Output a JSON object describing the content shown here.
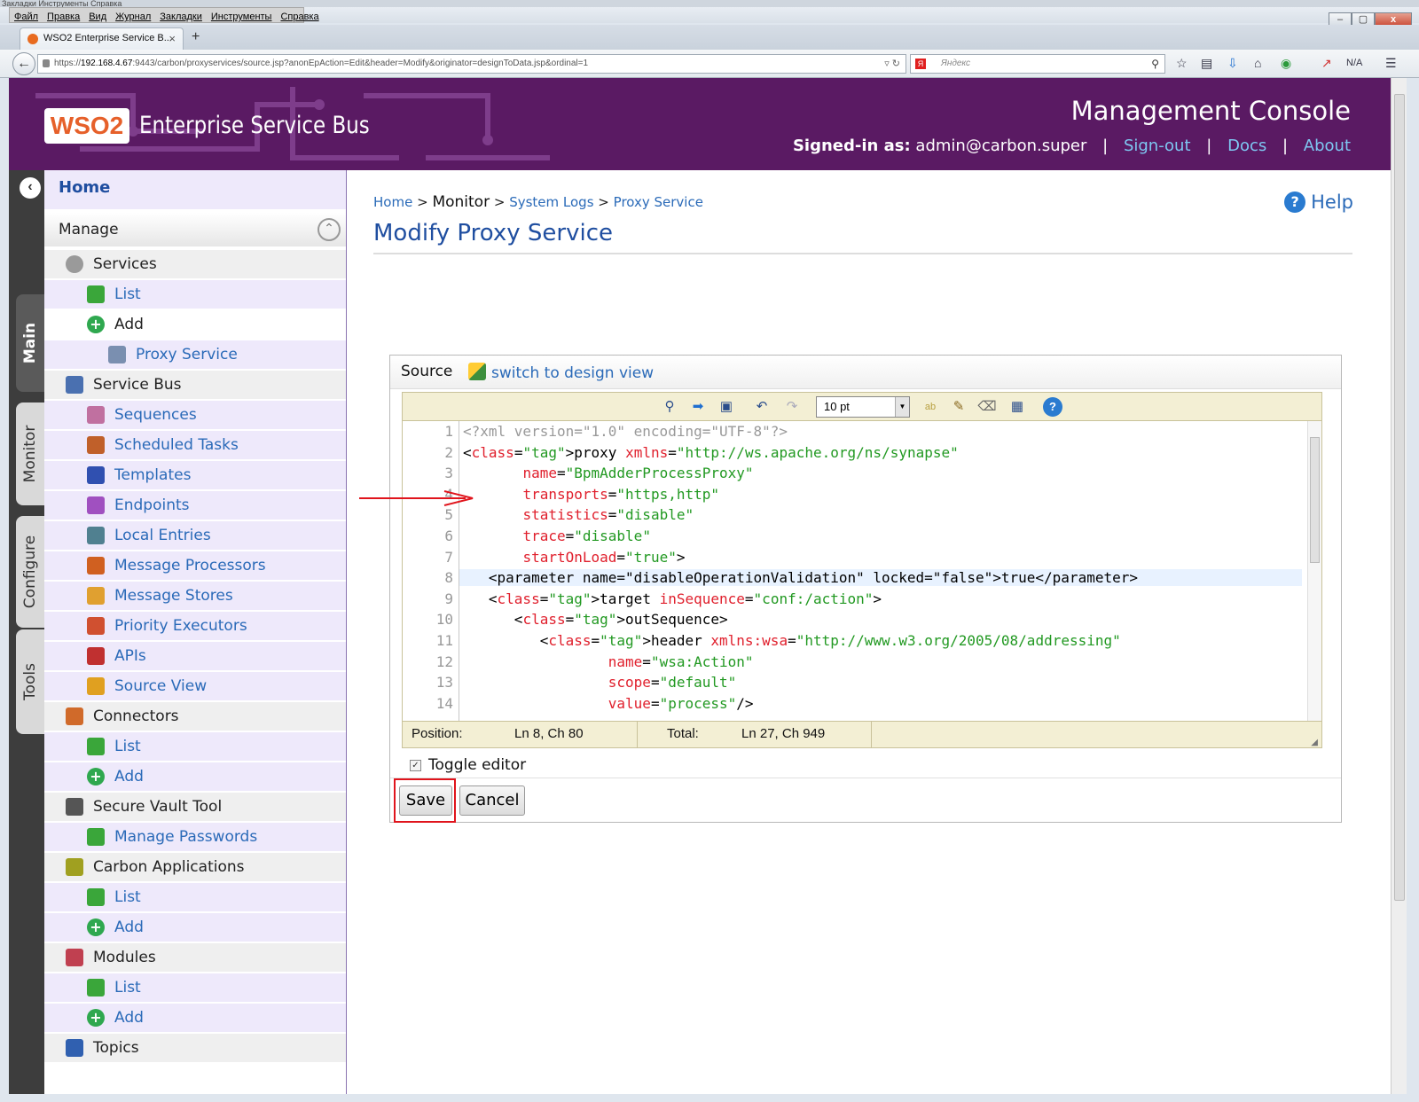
{
  "browser": {
    "ghost_menu": "Закладки  Инструменты  Справка",
    "menu": [
      "Файл",
      "Правка",
      "Вид",
      "Журнал",
      "Закладки",
      "Инструменты",
      "Справка"
    ],
    "tab_title": "WSO2 Enterprise Service B...",
    "tab_close": "×",
    "new_tab": "+",
    "url_prefix": "https://",
    "url_host": "192.168.4.67",
    "url_rest": ":9443/carbon/proxyservices/source.jsp?anonEpAction=Edit&header=Modify&originator=designToData.jsp&ordinal=1",
    "search_placeholder": "Яндекс",
    "na_label": "N/A",
    "window_controls": [
      "–",
      "▢",
      "x"
    ]
  },
  "header": {
    "logo_text": "WSO2",
    "product": "Enterprise Service Bus",
    "console_title": "Management Console",
    "signed_in_label": "Signed-in as:",
    "signed_in_user": "admin@carbon.super",
    "signout": "Sign-out",
    "docs": "Docs",
    "about": "About",
    "sep": "|",
    "color": "#5a1a63"
  },
  "vtabs": [
    "Main",
    "Monitor",
    "Configure",
    "Tools"
  ],
  "sidebar": {
    "home": "Home",
    "manage": "Manage",
    "items": [
      {
        "label": "Services",
        "level": 1,
        "icon": "gear-icon"
      },
      {
        "label": "List",
        "level": 2,
        "icon": "list-icon"
      },
      {
        "label": "Add",
        "level": 2,
        "icon": "add-icon",
        "plain": true
      },
      {
        "label": "Proxy Service",
        "level": 3,
        "icon": "proxy-icon"
      },
      {
        "label": "Service Bus",
        "level": 1,
        "icon": "servicebus-icon"
      },
      {
        "label": "Sequences",
        "level": 2,
        "icon": "sequences-icon"
      },
      {
        "label": "Scheduled Tasks",
        "level": 2,
        "icon": "tasks-icon"
      },
      {
        "label": "Templates",
        "level": 2,
        "icon": "templates-icon"
      },
      {
        "label": "Endpoints",
        "level": 2,
        "icon": "endpoints-icon"
      },
      {
        "label": "Local Entries",
        "level": 2,
        "icon": "local-entries-icon"
      },
      {
        "label": "Message Processors",
        "level": 2,
        "icon": "processors-icon"
      },
      {
        "label": "Message Stores",
        "level": 2,
        "icon": "stores-icon"
      },
      {
        "label": "Priority Executors",
        "level": 2,
        "icon": "executors-icon"
      },
      {
        "label": "APIs",
        "level": 2,
        "icon": "apis-icon"
      },
      {
        "label": "Source View",
        "level": 2,
        "icon": "source-view-icon"
      },
      {
        "label": "Connectors",
        "level": 1,
        "icon": "connectors-icon"
      },
      {
        "label": "List",
        "level": 2,
        "icon": "list-icon"
      },
      {
        "label": "Add",
        "level": 2,
        "icon": "add-icon"
      },
      {
        "label": "Secure Vault Tool",
        "level": 1,
        "icon": "lock-icon"
      },
      {
        "label": "Manage Passwords",
        "level": 2,
        "icon": "list-icon"
      },
      {
        "label": "Carbon Applications",
        "level": 1,
        "icon": "carbon-apps-icon"
      },
      {
        "label": "List",
        "level": 2,
        "icon": "list-icon"
      },
      {
        "label": "Add",
        "level": 2,
        "icon": "add-icon"
      },
      {
        "label": "Modules",
        "level": 1,
        "icon": "modules-icon"
      },
      {
        "label": "List",
        "level": 2,
        "icon": "list-icon"
      },
      {
        "label": "Add",
        "level": 2,
        "icon": "add-icon"
      },
      {
        "label": "Topics",
        "level": 1,
        "icon": "topics-icon"
      }
    ]
  },
  "main": {
    "crumb_home": "Home",
    "crumb_monitor": "Monitor",
    "crumb_logs": "System Logs",
    "crumb_proxy": "Proxy Service",
    "crumb_sep": ">",
    "help": "Help",
    "title": "Modify Proxy Service",
    "source_label": "Source",
    "switch_link": "switch to design view",
    "font_size": "10 pt",
    "code_lines": [
      "<?xml version=\"1.0\" encoding=\"UTF-8\"?>",
      "<proxy xmlns=\"http://ws.apache.org/ns/synapse\"",
      "       name=\"BpmAdderProcessProxy\"",
      "       transports=\"https,http\"",
      "       statistics=\"disable\"",
      "       trace=\"disable\"",
      "       startOnLoad=\"true\">",
      "   <parameter name=\"disableOperationValidation\" locked=\"false\">true</parameter>",
      "   <target inSequence=\"conf:/action\">",
      "      <outSequence>",
      "         <header xmlns:wsa=\"http://www.w3.org/2005/08/addressing\"",
      "                 name=\"wsa:Action\"",
      "                 scope=\"default\"",
      "                 value=\"process\"/>"
    ],
    "line_numbers": [
      "1",
      "2",
      "3",
      "4",
      "5",
      "6",
      "7",
      "8",
      "9",
      "10",
      "11",
      "12",
      "13",
      "14"
    ],
    "status_position_label": "Position:",
    "status_position_value": "Ln 8, Ch 80",
    "status_total_label": "Total:",
    "status_total_value": "Ln 27, Ch 949",
    "toggle_editor": "Toggle editor",
    "save": "Save",
    "cancel": "Cancel",
    "highlight_color": "#e0141c"
  }
}
